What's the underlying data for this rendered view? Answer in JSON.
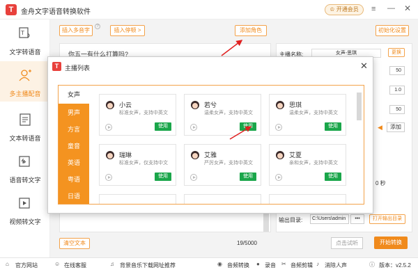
{
  "app": {
    "title": "金舟文字语音转换软件",
    "vip_label": "开通会员"
  },
  "sidebar": {
    "items": [
      {
        "label": "文字转语音"
      },
      {
        "label": "多主播配音"
      },
      {
        "label": "文本转语音"
      },
      {
        "label": "语音转文字"
      },
      {
        "label": "视频转文字"
      }
    ]
  },
  "toolbar": {
    "insert_polyphone": "插入多音字",
    "insert_pause": "插入停顿 >",
    "add_role": "添加角色",
    "init_settings": "初始化设置"
  },
  "editor": {
    "text": "你五一有什么打算吗?",
    "clear_label": "清空文本",
    "counter": "19/5000"
  },
  "right_panel": {
    "anchor_label": "主播名称:",
    "anchor_value": "女声-思琪",
    "change_label": "更换",
    "val1": "50",
    "val2": "1.0",
    "val3": "50",
    "add_label": "添加",
    "seconds_suffix": "0 秒",
    "output_label": "输出目录:",
    "output_path": "C:\\Users\\admin",
    "output_dots": "•••",
    "open_output_label": "打开输出目录",
    "trial_label": "点击试听",
    "start_label": "开始转换"
  },
  "modal": {
    "title": "主播列表",
    "categories": [
      "女声",
      "男声",
      "方言",
      "童音",
      "英语",
      "粤语",
      "日语"
    ],
    "voices": [
      {
        "name": "小云",
        "desc": "标准女声，支持中英文",
        "use": "使用"
      },
      {
        "name": "若兮",
        "desc": "温柔女声，支持中英文",
        "use": "使用"
      },
      {
        "name": "思琪",
        "desc": "温柔女声，支持中英文",
        "use": "使用"
      },
      {
        "name": "瑞琳",
        "desc": "标准女声，仅支持中文",
        "use": "使用"
      },
      {
        "name": "艾雅",
        "desc": "严厉女声，支持中英文",
        "use": "使用"
      },
      {
        "name": "艾夏",
        "desc": "亲和女声，支持中英文",
        "use": "使用"
      }
    ]
  },
  "bottombar": {
    "website": "官方网站",
    "service": "在线客服",
    "bgm": "背景音乐下载网址推荐",
    "audio_convert": "音频转换",
    "record": "录音",
    "audio_cut": "音频剪辑",
    "remove_voice": "消除人声",
    "version": "版本：v2.5.2"
  },
  "colors": {
    "accent": "#f08a1c",
    "use_green": "#1aa64a",
    "arrow_red": "#e02020"
  }
}
